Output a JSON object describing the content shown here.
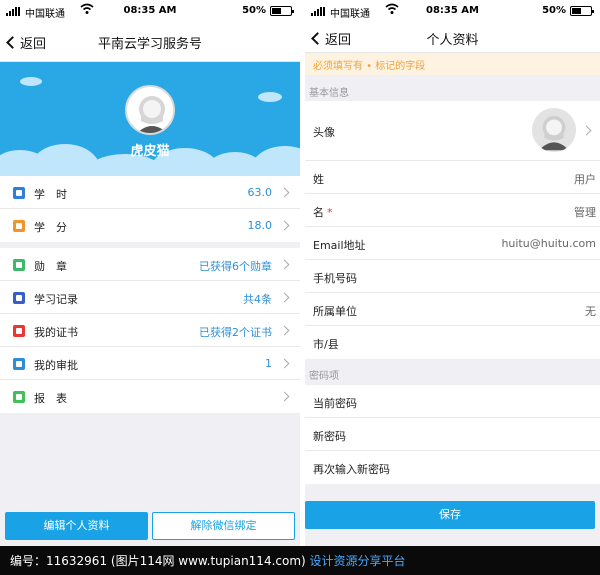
{
  "status_bar": {
    "carrier": "中国联通",
    "time": "08:35 AM",
    "battery": "50%"
  },
  "left": {
    "nav": {
      "back_label": "返回",
      "title": "平南云学习服务号"
    },
    "profile": {
      "name": "虎皮猫"
    },
    "group1": [
      {
        "label": "学　时",
        "value": "63.0",
        "icon_color": "#2f7fd6",
        "icon": "clock-icon"
      },
      {
        "label": "学　分",
        "value": "18.0",
        "icon_color": "#f0942b",
        "icon": "score-icon"
      }
    ],
    "group2": [
      {
        "label": "勋　章",
        "value": "已获得6个勋章",
        "icon_color": "#3cb96a",
        "icon": "medal-icon"
      },
      {
        "label": "学习记录",
        "value": "共4条",
        "icon_color": "#3a5fc4",
        "icon": "record-icon"
      },
      {
        "label": "我的证书",
        "value": "已获得2个证书",
        "icon_color": "#e8382f",
        "icon": "certificate-icon"
      },
      {
        "label": "我的审批",
        "value": "1",
        "icon_color": "#2a8fd8",
        "icon": "approval-icon"
      },
      {
        "label": "报　表",
        "value": "",
        "icon_color": "#44c05a",
        "icon": "report-icon"
      }
    ],
    "buttons": {
      "edit": "编辑个人资料",
      "unbind": "解除微信绑定"
    }
  },
  "right": {
    "nav": {
      "back_label": "返回",
      "title": "个人资料"
    },
    "notice": "必须填写有 • 标记的字段",
    "basic_section": "基本信息",
    "avatar_label": "头像",
    "fields": [
      {
        "label": "姓",
        "value": "用户",
        "required": false
      },
      {
        "label": "名",
        "value": "管理",
        "required": true
      },
      {
        "label": "Email地址",
        "value": "huitu@huitu.com",
        "required": false
      },
      {
        "label": "手机号码",
        "value": "",
        "required": false
      },
      {
        "label": "所属单位",
        "value": "无",
        "required": false
      },
      {
        "label": "市/县",
        "value": "",
        "required": false
      }
    ],
    "password_section": "密码项",
    "password_fields": [
      {
        "label": "当前密码"
      },
      {
        "label": "新密码"
      },
      {
        "label": "再次输入新密码"
      }
    ],
    "save_label": "保存"
  },
  "footer": {
    "text": "编号：11632961 (图片114网 www.tupian114.com)",
    "highlight": "设计资源分享平台"
  }
}
